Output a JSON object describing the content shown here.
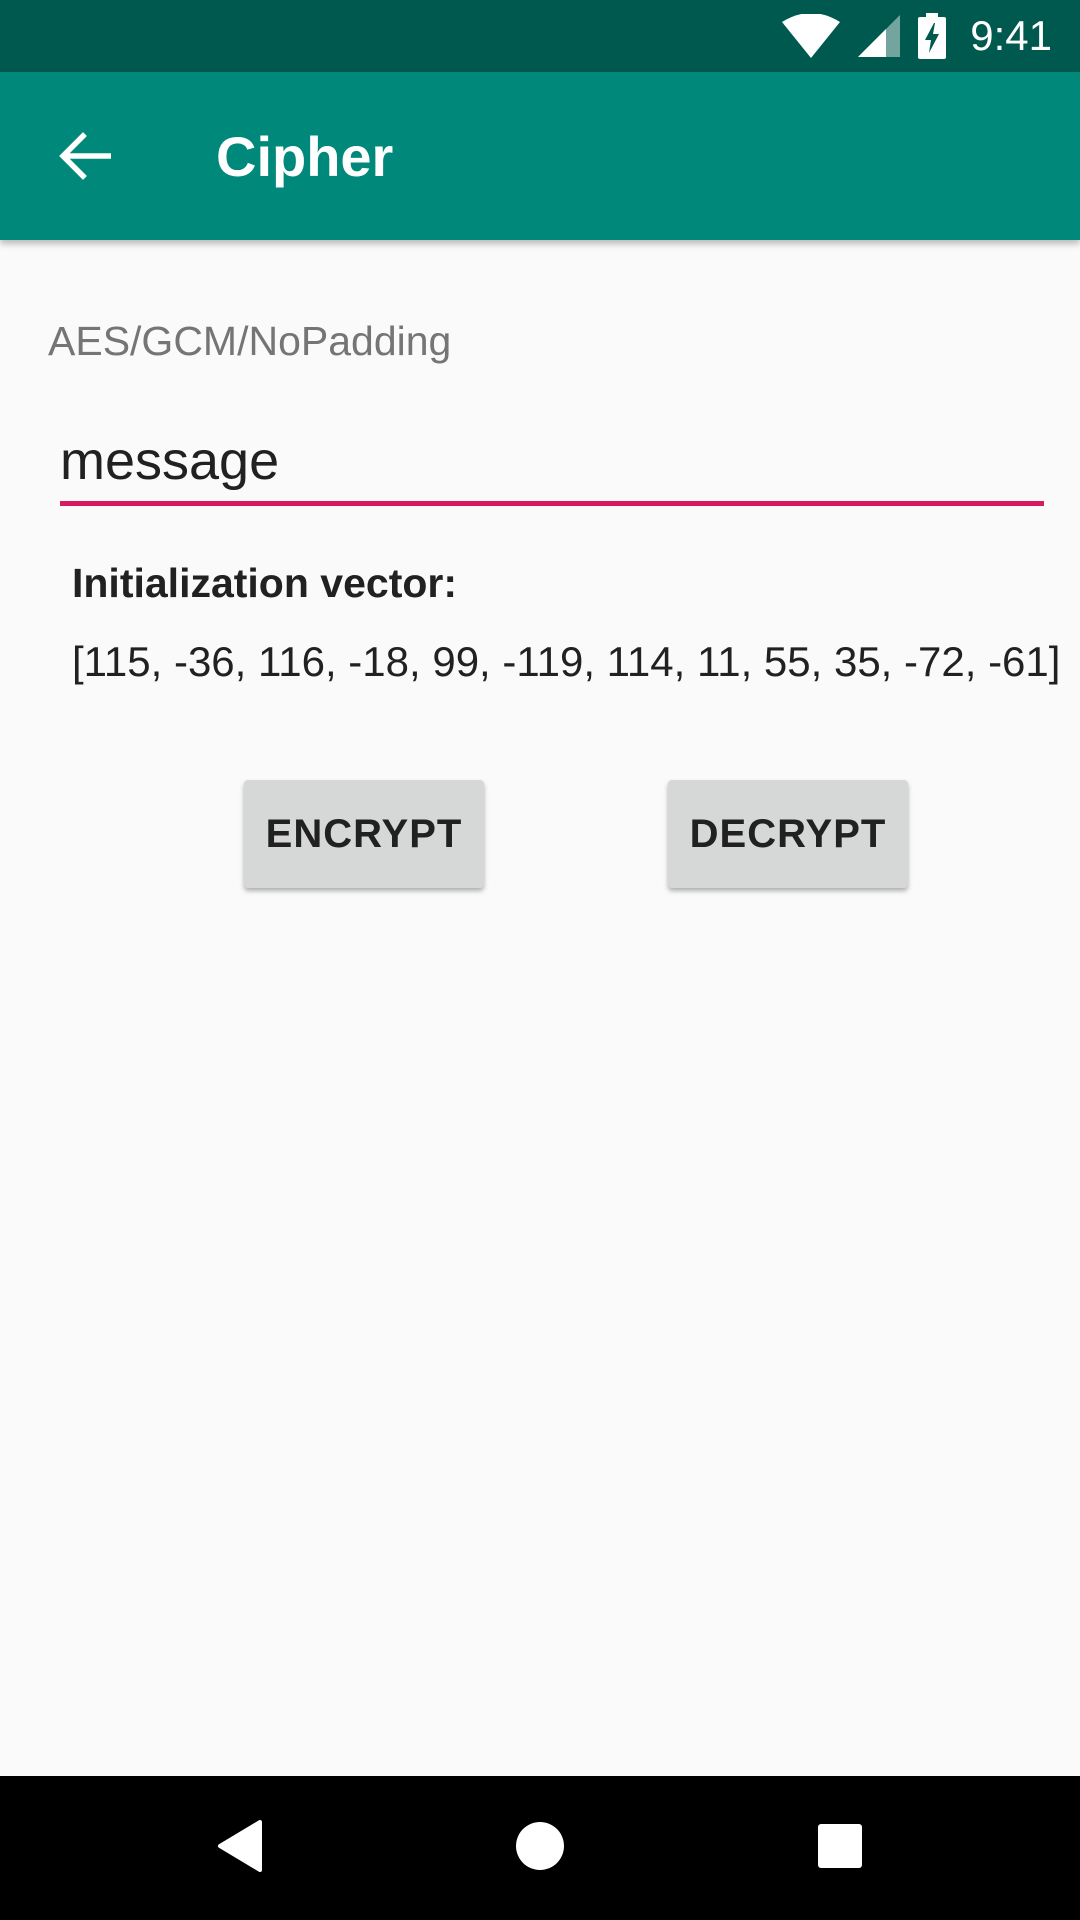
{
  "status_bar": {
    "time": "9:41",
    "icons": [
      "wifi-icon",
      "cell-signal-icon",
      "battery-charging-icon"
    ]
  },
  "app_bar": {
    "title": "Cipher",
    "back_icon": "arrow-back-icon"
  },
  "main": {
    "algorithm": "AES/GCM/NoPadding",
    "message_input": {
      "value": "message"
    },
    "iv_label": "Initialization vector:",
    "iv_value": "[115, -36, 116, -18, 99, -119, 114, 11, 55, 35, -72, -61]",
    "encrypt_label": "ENCRYPT",
    "decrypt_label": "DECRYPT"
  },
  "nav_bar": {
    "icons": [
      "nav-back-icon",
      "nav-home-icon",
      "nav-recents-icon"
    ]
  },
  "colors": {
    "status_bar": "#00594e",
    "app_bar": "#00897b",
    "accent": "#d81b60",
    "button": "#d6d7d7",
    "background": "#fafafa"
  }
}
